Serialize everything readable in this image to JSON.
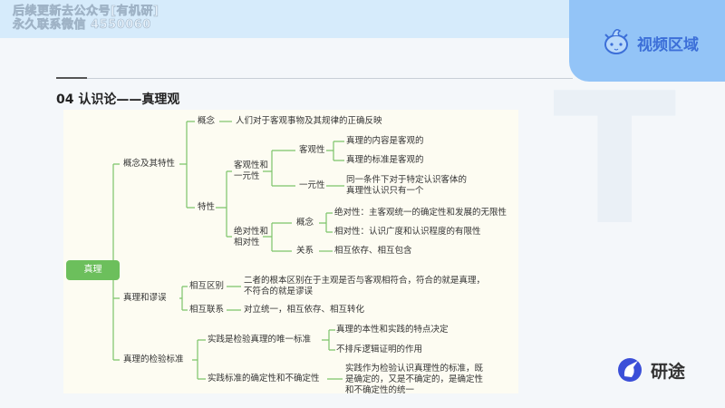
{
  "watermark": {
    "line1": "后续更新去公众号[有机研]",
    "line2": "永久联系微信 4550060"
  },
  "video_area": {
    "label": "视频区域",
    "icon": "mascot-icon"
  },
  "page_title": "04 认识论——真理观",
  "mindmap": {
    "root": "真理",
    "b1": {
      "label": "概念及其特性",
      "concept": "概念",
      "concept_text": "人们对于客观事物及其规律的正确反映",
      "traits": "特性",
      "t1": "客观性和",
      "t1b": "一元性",
      "obj": "客观性",
      "obj1": "真理的内容是客观的",
      "obj2": "真理的标准是客观的",
      "uni": "一元性",
      "uni1": "同一条件下对于特定认识客体的",
      "uni2": "真理性认识只有一个",
      "t2": "绝对性和",
      "t2b": "相对性",
      "c2": "概念",
      "abs": "绝对性：主客观统一的确定性和发展的无限性",
      "rel": "相对性：认识广度和认识程度的有限性",
      "relation": "关系",
      "relation_text": "相互依存、相互包含"
    },
    "b2": {
      "label": "真理和谬误",
      "diff": "相互区别",
      "diff1": "二者的根本区别在于主观是否与客观相符合，符合的就是真理，",
      "diff2": "不符合的就是谬误",
      "link": "相互联系",
      "link_text": "对立统一，相互依存、相互转化"
    },
    "b3": {
      "label": "真理的检验标准",
      "only": "实践是检验真理的唯一标准",
      "only1": "真理的本性和实践的特点决定",
      "only2": "不排斥逻辑证明的作用",
      "cert": "实践标准的确定性和不确定性",
      "cert1": "实践作为检验认识真理性的标准，既",
      "cert2": "是确定的，又是不确定的，是确定性",
      "cert3": "和不确定性的统一"
    }
  },
  "brand": {
    "name": "研途",
    "icon": "unicorn-logo-icon"
  },
  "colors": {
    "accent": "#6cbf5c",
    "video_bg": "#93c4f7",
    "video_text": "#3c6fd8",
    "brand_blue": "#3b4fd8"
  }
}
